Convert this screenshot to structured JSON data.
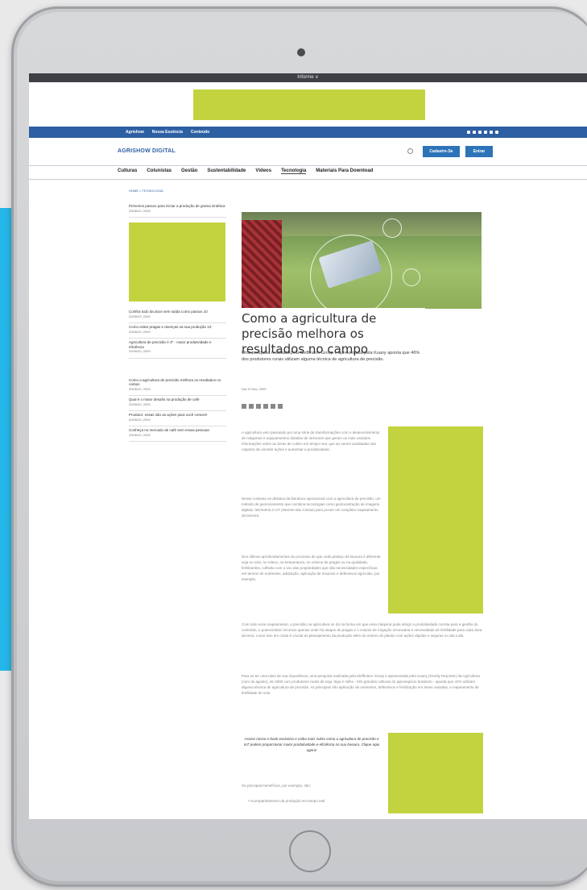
{
  "colors": {
    "accent_bar": "#25b7e8",
    "ad_placeholder": "#c3d33f",
    "site_blue": "#2d5fa3"
  },
  "topbar": {
    "label": "Informe ∨"
  },
  "bluebar": {
    "links": [
      "Agrishow",
      "Nossa Essência",
      "Conteúdo"
    ]
  },
  "header": {
    "logo": "AGRISHOW DIGITAL",
    "btn_primary": "Cadastre-Se",
    "btn_secondary": "Entrar"
  },
  "nav": [
    "Culturas",
    "Colunistas",
    "Gestão",
    "Sustentabilidade",
    "Vídeos",
    "Tecnologia",
    "Materiais Para Download"
  ],
  "breadcrumb": "HOME  >  TECNOLOGIA",
  "sidebar": {
    "top_item": {
      "title": "Primeiros passos para iniciar a produção de grama sintética",
      "date": "20/06/20, 2000"
    },
    "items": [
      {
        "title": "Confira tudo da doce sem saída como passos 10",
        "date": "20/06/20, 2000"
      },
      {
        "title": "Como evitar pragas e doenças na sua produção 10",
        "date": "20/06/20, 2000"
      },
      {
        "title": "Agricultura de precisão é 4ª - maior produtividade e eficiência",
        "date": "20/06/20, 2000"
      },
      {
        "title": "Como a agricultura de precisão melhora os resultados no campo",
        "date": "20/06/20, 2000"
      },
      {
        "title": "Qual é o maior desafio na produção de café",
        "date": "20/06/20, 2000"
      },
      {
        "title": "Produtor: essas são as ações para você crescer!",
        "date": "20/06/20, 2000"
      },
      {
        "title": "Conheça no mercado de café sem essas pessoas",
        "date": "20/06/20, 2000"
      }
    ]
  },
  "article": {
    "title": "Como a agricultura de precisão melhora os resultados no campo",
    "subtitle": "Uma pesquisa realizada pela Kleffmann Group e apresentada pela Kuany aponta que 46% dos produtores rurais utilizam alguma técnica de agricultura de precisão.",
    "byline": "Dia 19 Nov, 2000",
    "p1": "A agricultura vem passando por uma série de transformações com o desenvolvimento de máquinas e equipamentos dotados de sensores que geram os mais variados informações sobre as áreas de cultivo em tempo real, que ao serem analisadas são capazes de orientar ações e aumentar a produtividade.",
    "p2": "Nesse contexto se destaca da literatura operacional com a agricultura de precisão, um método de gerenciamento que combina tecnologias como geolocalização de imagens digitais, telemetria e IoT (Internet das Coisas) para prover um completo mapeamento da lavoura.",
    "p3": "Nos últimos aprofundamentos do processo de que cada pedaço de lavoura é diferente: seja no solo, no relevo, na temperatura, no volume de pragas ou na qualidade, fertilizantes, colheita com o uso das propriedades que são necessidades específicas em termos de nutrientes, adubação, aplicação de insumos e defensivos agrícolas, por exemplo.",
    "p4": "Com todo esse mapeamento, a precisão na agricultura se dá na forma em que essa máquina pode atingir a produtividade correta para a gestão do conteúdo, e potencializar recursos apenas onde há ataque de pragas e o volume de irrigação necessária e necessidade de fertilidade para cada área da terra. Levar isso em conta é crucial ao planejamento da produção além do retorno do plantio com ações rápidas e seguras no dia a dia.",
    "p5": "Para se ter uma ideia de sua importância, uma pesquisa realizada pela Kleffmann Group e apresentada pela Kuany (Greely Reporter) da Agricultura (com de agosto), de 2000 com produtores rurais de soja, trigo e milho - três grandes culturas do agronegócio brasileiro - aponta que 44% utilizam alguma técnica de agricultura de precisão. As principais são aplicação de nutrientes, defensivos e fertilização em áreas variadas, e mapeamento de fertilidade de solo.",
    "callout": "Assine nosso e-book exclusivo e saiba mais sobre como a agricultura de precisão e IoT podem proporcionar maior produtividade e eficiência na sua lavoura. Clique aqui agora!",
    "p6": "Os principais benefícios, por exemplo, são:",
    "bullet1": "• Acompanhamento da produção em tempo real"
  }
}
